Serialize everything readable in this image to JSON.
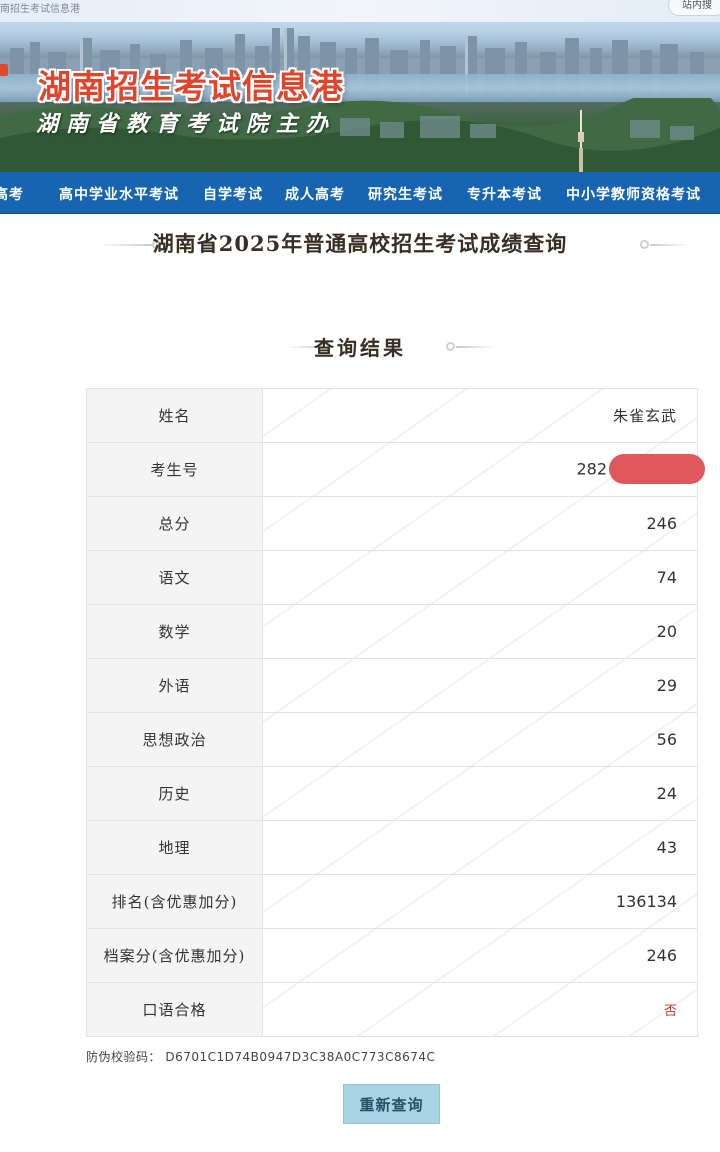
{
  "banner": {
    "small_title": "南招生考试信息港",
    "search_label": "站内搜",
    "logo_main": "湖南招生考试信息港",
    "logo_sub": "湖南省教育考试院主办"
  },
  "nav": {
    "items": [
      "高考",
      "高中学业水平考试",
      "自学考试",
      "成人高考",
      "研究生考试",
      "专升本考试",
      "中小学教师资格考试"
    ]
  },
  "page": {
    "title": "湖南省2025年普通高校招生考试成绩查询",
    "section_title": "查询结果"
  },
  "results": {
    "rows": [
      {
        "label": "姓名",
        "value": "朱雀玄武"
      },
      {
        "label": "考生号",
        "value": "282"
      },
      {
        "label": "总分",
        "value": "246"
      },
      {
        "label": "语文",
        "value": "74"
      },
      {
        "label": "数学",
        "value": "20"
      },
      {
        "label": "外语",
        "value": "29"
      },
      {
        "label": "思想政治",
        "value": "56"
      },
      {
        "label": "历史",
        "value": "24"
      },
      {
        "label": "地理",
        "value": "43"
      },
      {
        "label": "排名(含优惠加分)",
        "value": "136134"
      },
      {
        "label": "档案分(含优惠加分)",
        "value": "246"
      },
      {
        "label": "口语合格",
        "value": "否"
      }
    ]
  },
  "verify": {
    "label": "防伪校验码：",
    "code": "D6701C1D74B0947D3C38A0C773C8674C"
  },
  "actions": {
    "requery_label": "重新查询"
  },
  "colors": {
    "nav_bg": "#1764b0",
    "logo_red": "#e0442a",
    "button_bg": "#a9d4e4",
    "no_red": "#c0392b",
    "redaction": "#e0585b"
  }
}
